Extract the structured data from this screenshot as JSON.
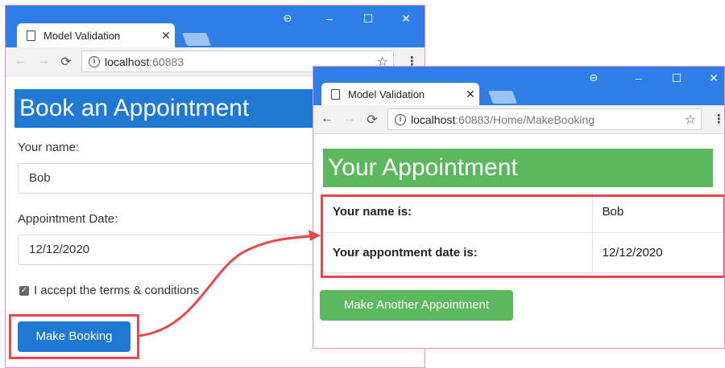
{
  "colors": {
    "titlebar": "#2f7ee8",
    "primary": "#1f78d1",
    "success": "#5cb85c",
    "highlight": "#e5474a",
    "window_outline": "#e58be3"
  },
  "window_back": {
    "tab_title": "Model Validation",
    "tab_close": "✕",
    "controls": {
      "account": "⊖",
      "minimize": "–",
      "maximize": "☐",
      "close": "✕"
    },
    "url_host": "localhost",
    "url_rest": ":60883",
    "heading": "Book an Appointment",
    "name_label": "Your name:",
    "name_value": "Bob",
    "date_label": "Appointment Date:",
    "date_value": "12/12/2020",
    "terms_checked": true,
    "terms_label": "I accept the terms & conditions",
    "submit_label": "Make Booking"
  },
  "window_front": {
    "tab_title": "Model Validation",
    "tab_close": "✕",
    "controls": {
      "account": "⊖",
      "minimize": "–",
      "maximize": "☐",
      "close": "✕"
    },
    "url_host": "localhost",
    "url_rest": ":60883/Home/MakeBooking",
    "heading": "Your Appointment",
    "rows": [
      {
        "key": "Your name is:",
        "value": "Bob"
      },
      {
        "key": "Your appontment date is:",
        "value": "12/12/2020"
      }
    ],
    "again_label": "Make Another Appointment"
  },
  "icons": {
    "back": "back-arrow-icon",
    "forward": "forward-arrow-icon",
    "reload": "reload-icon",
    "info": "info-icon",
    "star": "bookmark-star-icon",
    "menu": "menu-kebab-icon",
    "page": "page-icon",
    "checkbox": "checkbox-checked-icon"
  }
}
